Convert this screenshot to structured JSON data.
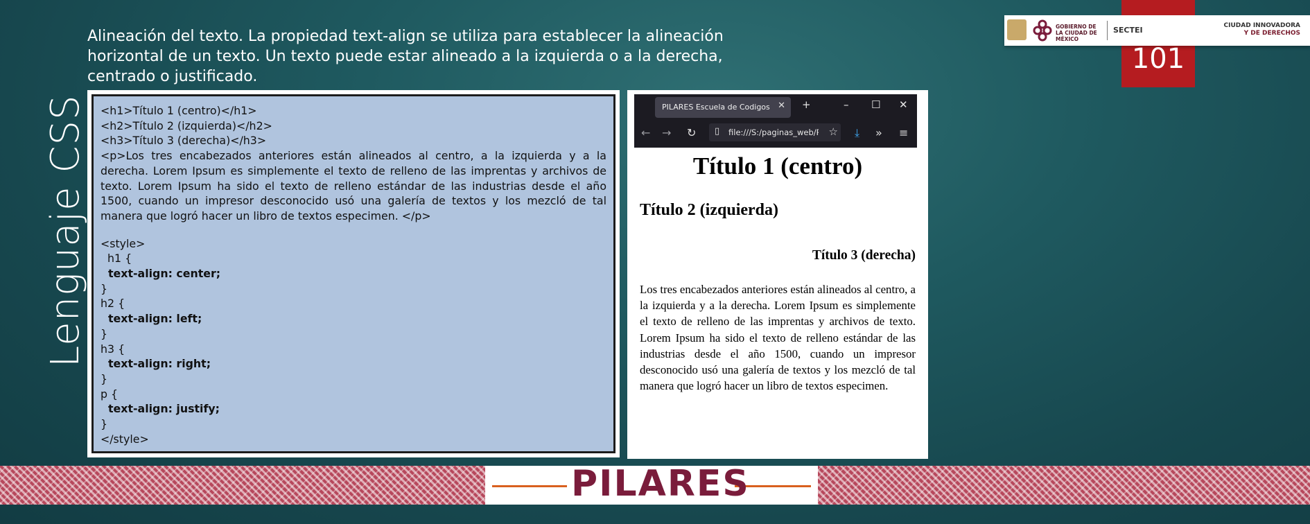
{
  "side_title": "Lenguaje CSS",
  "intro_text": "Alineación del texto. La propiedad text-align se utiliza para establecer la alineación horizontal de un texto. Un texto puede estar alineado a la izquierda o a la derecha, centrado o justificado.",
  "code": {
    "html_lines": [
      "<h1>Título 1 (centro)</h1>",
      "<h2>Título 2 (izquierda)</h2>",
      "<h3>Título 3 (derecha)</h3>"
    ],
    "paragraph": "<p>Los tres encabezados anteriores están alineados al centro, a la izquierda y a la derecha. Lorem Ipsum es simplemente el texto de relleno de las imprentas y archivos de texto. Lorem Ipsum ha sido el texto de relleno estándar de las industrias desde el año 1500, cuando un impresor desconocido usó una galería de textos y los mezcló de tal manera que logró hacer un libro de textos especimen. </p>",
    "style_open": "<style>",
    "rules": [
      {
        "selector": "  h1 {",
        "decl": "  text-align: center;",
        "close": "}"
      },
      {
        "selector": "h2 {",
        "decl": "  text-align: left;",
        "close": "}"
      },
      {
        "selector": "h3 {",
        "decl": "  text-align: right;",
        "close": "}"
      },
      {
        "selector": "p {",
        "decl": "  text-align: justify;",
        "close": "}"
      }
    ],
    "style_close": "</style>"
  },
  "browser": {
    "tab_title": "PILARES Escuela de Codigos",
    "url": "file:///S:/paginas_web/PI",
    "page": {
      "h1": "Título 1 (centro)",
      "h2": "Título 2 (izquierda)",
      "h3": "Título 3 (derecha)",
      "p": "Los tres encabezados anteriores están alineados al centro, a la izquierda y a la derecha. Lorem Ipsum es simplemente el texto de relleno de las imprentas y archivos de texto. Lorem Ipsum ha sido el texto de relleno estándar de las industrias desde el año 1500, cuando un impresor desconocido usó una galería de textos y los mezcló de tal manera que logró hacer un libro de textos especimen."
    }
  },
  "logos": {
    "gobierno": "GOBIERNO DE LA CIUDAD DE MÉXICO",
    "sectei": "SECTEI",
    "ciudad_line1": "CIUDAD INNOVADORA",
    "ciudad_line2": "Y DE DERECHOS"
  },
  "page_number": "101",
  "brand": "PILARES",
  "colors": {
    "background": "#1f5a60",
    "code_bg": "#b0c4de",
    "page_number_bg": "#b51c20",
    "brand_maroon": "#7a1c3b",
    "brand_gold": "#c8a063",
    "accent_orange": "#d9601e"
  }
}
